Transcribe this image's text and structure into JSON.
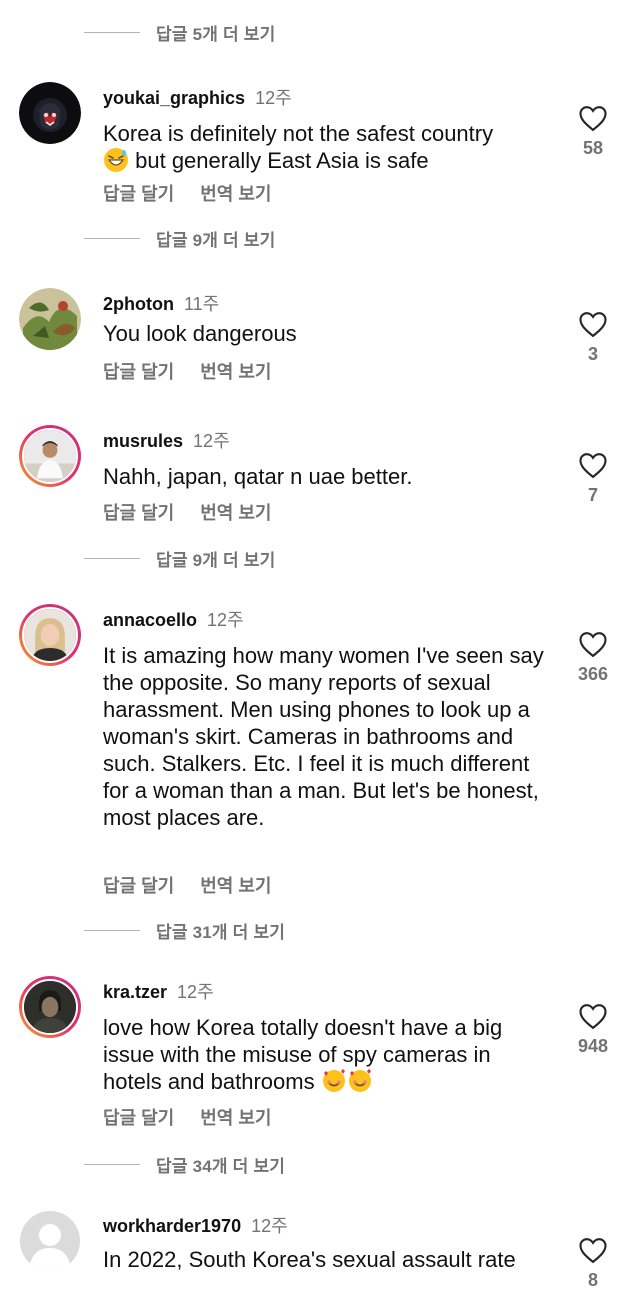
{
  "more_replies": [
    "답글 5개 더 보기",
    "답글 9개 더 보기",
    "답글 9개 더 보기",
    "답글 31개 더 보기",
    "답글 34개 더 보기"
  ],
  "comments": [
    {
      "username": "youkai_graphics",
      "time": "12주",
      "text_line1": "Korea is definitely not the safest country",
      "text_line2": "but generally East Asia is safe",
      "likes": "58",
      "reply": "답글 달기",
      "translate": "번역 보기"
    },
    {
      "username": "2photon",
      "time": "11주",
      "text": "You look dangerous",
      "likes": "3",
      "reply": "답글 달기",
      "translate": "번역 보기"
    },
    {
      "username": "musrules",
      "time": "12주",
      "text": "Nahh, japan, qatar n uae better.",
      "likes": "7",
      "reply": "답글 달기",
      "translate": "번역 보기"
    },
    {
      "username": "annacoello",
      "time": "12주",
      "text": "It is amazing how many women I've seen say the opposite. So many reports of sexual harassment. Men using phones to look up a woman's skirt. Cameras in bathrooms and such. Stalkers. Etc. I feel it is much different for a woman than a man. But let's be honest, most places are.",
      "likes": "366",
      "reply": "답글 달기",
      "translate": "번역 보기"
    },
    {
      "username": "kra.tzer",
      "time": "12주",
      "text": "love how Korea totally doesn't have a big issue with the misuse of spy cameras in hotels and bathrooms",
      "likes": "948",
      "reply": "답글 달기",
      "translate": "번역 보기"
    },
    {
      "username": "workharder1970",
      "time": "12주",
      "text": "In 2022, South Korea's sexual assault rate",
      "likes": "8"
    }
  ],
  "colors": {
    "muted": "#737373",
    "story_ring": "#e1306c"
  },
  "icons": {
    "like": "heart-outline-icon",
    "emoji_grin": "grinning-sweat-emoji",
    "emoji_love": "smiling-hearts-emoji"
  }
}
